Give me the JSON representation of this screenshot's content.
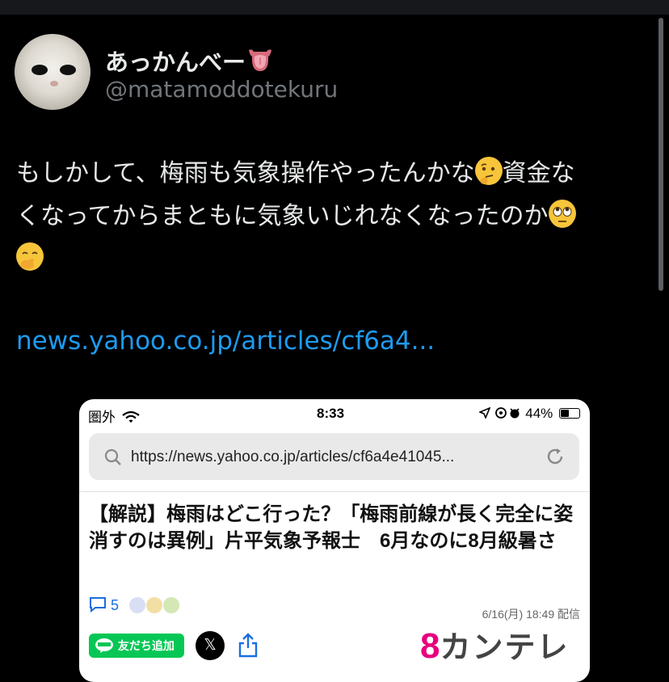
{
  "tweet": {
    "display_name": "あっかんべー",
    "display_name_emoji": "tongue-emoji",
    "handle": "@matamoddotekuru",
    "text_line1": "もしかして、梅雨も気象操作やったんかな",
    "text_line1b": "資金な",
    "text_line2": "くなってからまともに気象いじれなくなったのか",
    "link_text": "news.yahoo.co.jp/articles/cf6a4..."
  },
  "embed": {
    "status_bar": {
      "carrier": "圏外",
      "time": "8:33",
      "battery": "44%"
    },
    "url": "https://news.yahoo.co.jp/articles/cf6a4e41045...",
    "headline": "【解説】梅雨はどこ行った？「梅雨前線が長く完全に姿消すのは異例」片平気象予報士　6月なのに8月級暑さ",
    "comment_count": "5",
    "date": "6/16(月) 18:49 配信",
    "line_button": "友だち追加",
    "x_button": "𝕏",
    "logo_number": "8",
    "logo_text": "カンテレ"
  },
  "icons": [
    "thinking-face-emoji",
    "face-with-rolling-eyes-emoji",
    "face-with-hand-over-mouth-emoji",
    "search-icon",
    "reload-icon",
    "wifi-icon",
    "location-icon",
    "alarm-icon",
    "battery-icon",
    "comment-icon",
    "share-icon",
    "line-icon"
  ],
  "colors": {
    "link": "#1d9bf0",
    "line_green": "#06c755",
    "kantele_pink": "#e6007e",
    "secondary_text": "#71767b"
  }
}
